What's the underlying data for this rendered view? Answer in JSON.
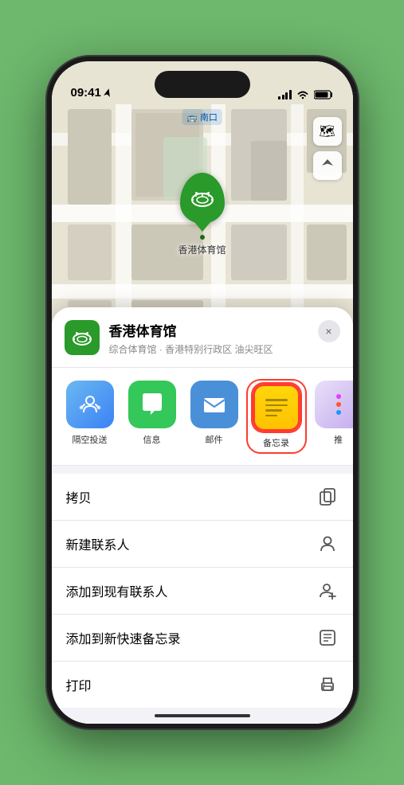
{
  "status_bar": {
    "time": "09:41",
    "location_arrow": "▶",
    "wifi": "wifi",
    "battery": "battery"
  },
  "map": {
    "label": "南口",
    "label_prefix": "🚌",
    "venue_name_map": "香港体育馆",
    "controls": {
      "map_icon": "🗺",
      "location_icon": "➤"
    }
  },
  "venue": {
    "name": "香港体育馆",
    "subtitle": "综合体育馆 · 香港特别行政区 油尖旺区",
    "logo_icon": "🏟"
  },
  "share_actions": [
    {
      "id": "airdrop",
      "label": "隔空投送",
      "type": "airdrop"
    },
    {
      "id": "messages",
      "label": "信息",
      "type": "messages"
    },
    {
      "id": "mail",
      "label": "邮件",
      "type": "mail"
    },
    {
      "id": "notes",
      "label": "备忘录",
      "type": "notes"
    },
    {
      "id": "more",
      "label": "推",
      "type": "more"
    }
  ],
  "action_items": [
    {
      "id": "copy",
      "label": "拷贝",
      "icon": "copy"
    },
    {
      "id": "new_contact",
      "label": "新建联系人",
      "icon": "person"
    },
    {
      "id": "add_existing",
      "label": "添加到现有联系人",
      "icon": "person_add"
    },
    {
      "id": "add_notes",
      "label": "添加到新快速备忘录",
      "icon": "notes_alt"
    },
    {
      "id": "print",
      "label": "打印",
      "icon": "printer"
    }
  ],
  "close_label": "×"
}
